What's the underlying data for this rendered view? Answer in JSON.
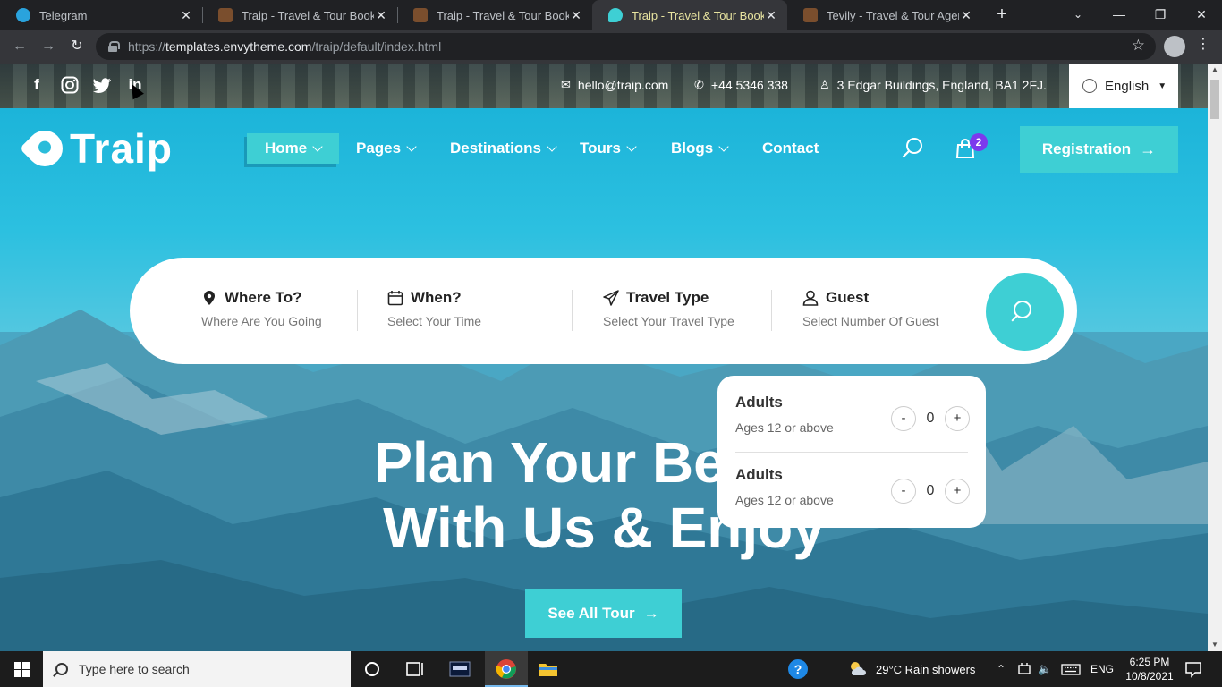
{
  "browser": {
    "tabs": [
      {
        "title": "Telegram",
        "favicon_color": "#2aa3dd",
        "active": false
      },
      {
        "title": "Traip - Travel & Tour Booking",
        "favicon_color": "#7a4e2d",
        "active": false
      },
      {
        "title": "Traip - Travel & Tour Booking",
        "favicon_color": "#7a4e2d",
        "active": false
      },
      {
        "title": "Traip - Travel & Tour Booking",
        "favicon_color": "#3ecfd4",
        "active": true
      },
      {
        "title": "Tevily - Travel & Tour Agency",
        "favicon_color": "#7a4e2d",
        "active": false
      }
    ],
    "url_prefix": "https://",
    "url_host": "templates.envytheme.com",
    "url_path": "/traip/default/index.html"
  },
  "site": {
    "topbar": {
      "email": "hello@traip.com",
      "phone": "+44 5346 338",
      "address": "3 Edgar Buildings, England, BA1 2FJ.",
      "language": "English"
    },
    "logo_text": "Traip",
    "nav": [
      {
        "label": "Home",
        "has_dropdown": true
      },
      {
        "label": "Pages",
        "has_dropdown": true
      },
      {
        "label": "Destinations",
        "has_dropdown": true
      },
      {
        "label": "Tours",
        "has_dropdown": true
      },
      {
        "label": "Blogs",
        "has_dropdown": true
      },
      {
        "label": "Contact",
        "has_dropdown": false
      }
    ],
    "cart_count": "2",
    "registration_label": "Registration",
    "search": {
      "where_label": "Where To?",
      "where_placeholder": "Where Are You Going",
      "when_label": "When?",
      "when_placeholder": "Select Your Time",
      "type_label": "Travel Type",
      "type_placeholder": "Select Your Travel Type",
      "guest_label": "Guest",
      "guest_placeholder": "Select Number Of Guest"
    },
    "guest_popup": [
      {
        "title": "Adults",
        "subtitle": "Ages 12 or above",
        "value": "0",
        "minus": "-",
        "plus": "+"
      },
      {
        "title": "Adults",
        "subtitle": "Ages 12 or above",
        "value": "0",
        "minus": "-",
        "plus": "+"
      }
    ],
    "hero_line1": "Plan Your Best H",
    "hero_line2": "With Us & Enjoy",
    "see_all_label": "See All Tour",
    "accent_color": "#3ecfd4"
  },
  "taskbar": {
    "search_placeholder": "Type here to search",
    "weather": "29°C  Rain showers",
    "lang": "ENG",
    "time": "6:25 PM",
    "date": "10/8/2021"
  }
}
